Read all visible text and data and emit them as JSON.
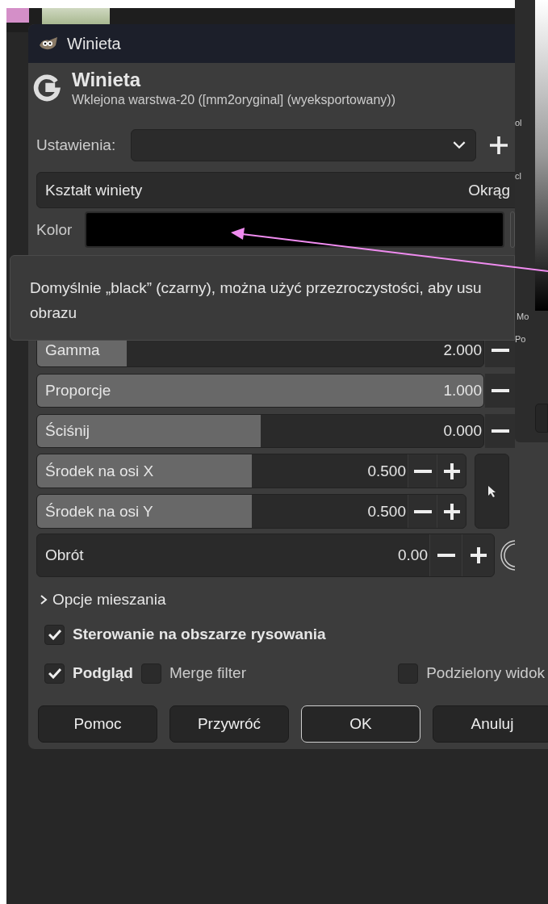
{
  "title_bar": {
    "title": "Winieta"
  },
  "header": {
    "title": "Winieta",
    "subtitle": "Wklejona warstwa-20 ([mm2oryginal] (wyeksportowany))"
  },
  "presets": {
    "label": "Ustawienia:"
  },
  "shape": {
    "label": "Kształt winiety",
    "value": "Okrąg"
  },
  "color": {
    "label": "Kolor"
  },
  "tooltip": {
    "lines": [
      "Domyślnie „black” (czarny), można użyć przezroczystości, aby usu",
      "obrazu"
    ]
  },
  "sliders": [
    {
      "kind": "full",
      "label": "Gamma",
      "value": "2.000",
      "level": 0.2
    },
    {
      "kind": "full",
      "label": "Proporcje",
      "value": "1.000",
      "level": 1.0
    },
    {
      "kind": "full",
      "label": "Ściśnij",
      "value": "0.000",
      "level": 0.5
    },
    {
      "kind": "paired",
      "label": "Środek na osi X",
      "value": "0.500",
      "level": 0.5
    },
    {
      "kind": "paired",
      "label": "Środek na osi Y",
      "value": "0.500",
      "level": 0.5
    },
    {
      "kind": "angle",
      "label": "Obrót",
      "value": "0.00",
      "level": 0
    }
  ],
  "blending": {
    "label": "Opcje mieszania",
    "expanded": false
  },
  "on_canvas": {
    "label": "Sterowanie na obszarze rysowania",
    "checked": true
  },
  "options": [
    {
      "label": "Podgląd",
      "checked": true
    },
    {
      "label": "Merge filter",
      "checked": false
    },
    {
      "label": "Podzielony widok",
      "checked": false
    }
  ],
  "buttons": [
    {
      "label": "Pomoc",
      "default": false
    },
    {
      "label": "Przywróć",
      "default": false
    },
    {
      "label": "OK",
      "default": true
    },
    {
      "label": "Anuluj",
      "default": false
    }
  ],
  "background_window": {
    "labels": [
      "ol",
      "cl",
      "Mo",
      "Po"
    ]
  }
}
